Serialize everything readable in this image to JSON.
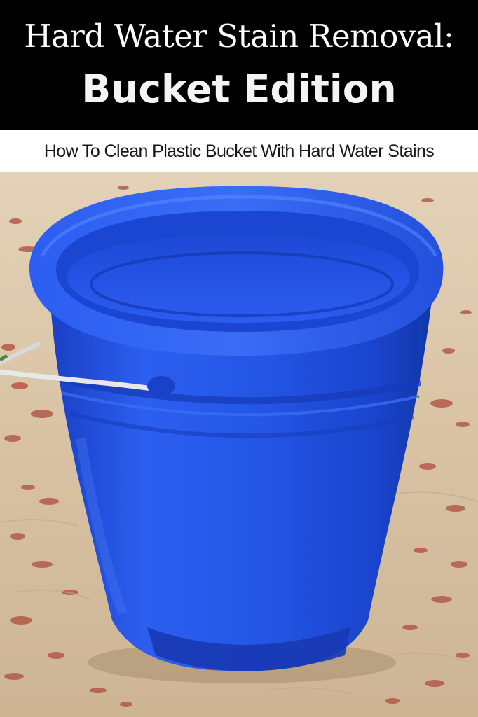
{
  "title": {
    "line1": "Hard Water Stain Removal:",
    "line2": "Bucket Edition"
  },
  "subtitle": "How To Clean Plastic Bucket With Hard Water Stains",
  "photo": {
    "subject": "blue-plastic-bucket",
    "colors": {
      "bucket": "#1f4fe0",
      "bucket_dark": "#0f2fa8",
      "bucket_light": "#3e72f2",
      "ground": "#d9c4a6",
      "stain": "#b35a4a",
      "handle": "#e8e8ea"
    }
  }
}
